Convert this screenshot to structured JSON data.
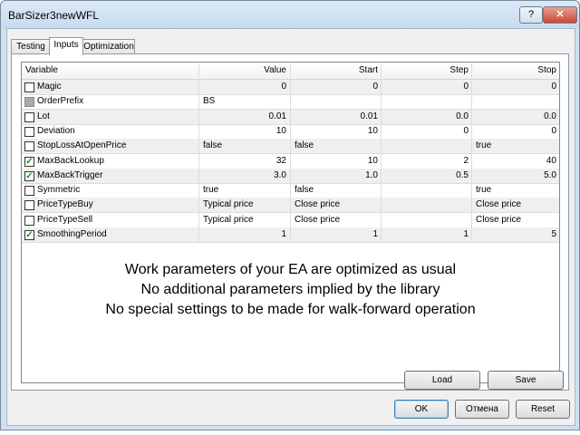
{
  "window": {
    "title": "BarSizer3newWFL",
    "help_glyph": "?",
    "close_glyph": "✕"
  },
  "tabs": [
    {
      "label": "Testing"
    },
    {
      "label": "Inputs"
    },
    {
      "label": "Optimization"
    }
  ],
  "grid": {
    "headers": {
      "variable": "Variable",
      "value": "Value",
      "start": "Start",
      "step": "Step",
      "stop": "Stop"
    },
    "rows": [
      {
        "checked": false,
        "disabled": false,
        "name": "Magic",
        "value": "0",
        "start": "0",
        "step": "0",
        "stop": "0"
      },
      {
        "checked": false,
        "disabled": true,
        "name": "OrderPrefix",
        "value": "BS",
        "start": "",
        "step": "",
        "stop": ""
      },
      {
        "checked": false,
        "disabled": false,
        "name": "Lot",
        "value": "0.01",
        "start": "0.01",
        "step": "0.0",
        "stop": "0.0"
      },
      {
        "checked": false,
        "disabled": false,
        "name": "Deviation",
        "value": "10",
        "start": "10",
        "step": "0",
        "stop": "0"
      },
      {
        "checked": false,
        "disabled": false,
        "name": "StopLossAtOpenPrice",
        "value": "false",
        "start": "false",
        "step": "",
        "stop": "true"
      },
      {
        "checked": true,
        "disabled": false,
        "name": "MaxBackLookup",
        "value": "32",
        "start": "10",
        "step": "2",
        "stop": "40"
      },
      {
        "checked": true,
        "disabled": false,
        "name": "MaxBackTrigger",
        "value": "3.0",
        "start": "1.0",
        "step": "0.5",
        "stop": "5.0"
      },
      {
        "checked": false,
        "disabled": false,
        "name": "Symmetric",
        "value": "true",
        "start": "false",
        "step": "",
        "stop": "true"
      },
      {
        "checked": false,
        "disabled": false,
        "name": "PriceTypeBuy",
        "value": "Typical price",
        "start": "Close price",
        "step": "",
        "stop": "Close price"
      },
      {
        "checked": false,
        "disabled": false,
        "name": "PriceTypeSell",
        "value": "Typical price",
        "start": "Close price",
        "step": "",
        "stop": "Close price"
      },
      {
        "checked": true,
        "disabled": false,
        "name": "SmoothingPeriod",
        "value": "1",
        "start": "1",
        "step": "1",
        "stop": "5"
      }
    ]
  },
  "overlay_text": [
    "Work parameters of your EA are optimized as usual",
    "No additional parameters implied by the library",
    "No special settings to be made for walk-forward operation"
  ],
  "panel_buttons": {
    "load": "Load",
    "save": "Save"
  },
  "dialog_buttons": {
    "ok": "OK",
    "cancel": "Отмена",
    "reset": "Reset"
  }
}
